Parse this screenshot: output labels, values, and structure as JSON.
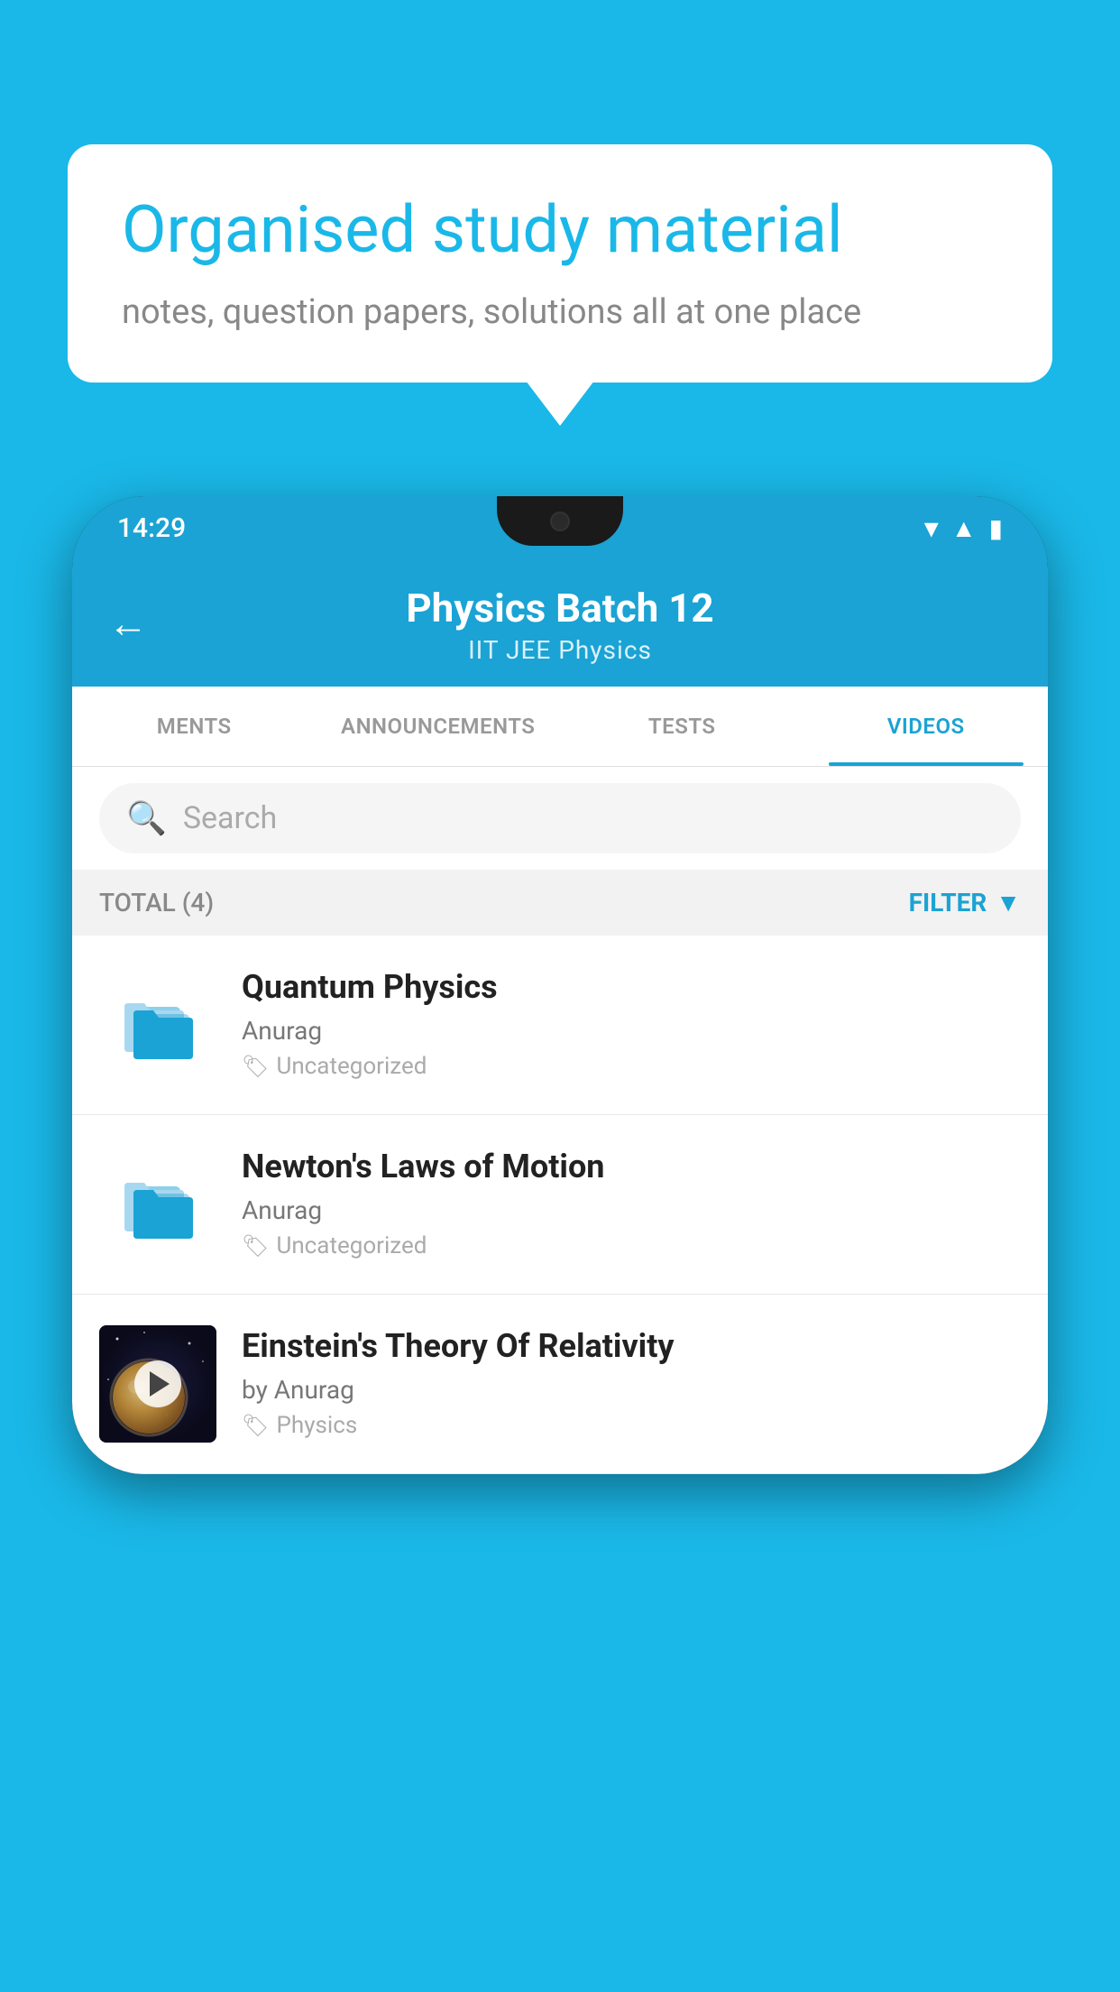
{
  "background_color": "#1ab8e8",
  "speech_bubble": {
    "title": "Organised study material",
    "subtitle": "notes, question papers, solutions all at one place"
  },
  "status_bar": {
    "time": "14:29"
  },
  "app_header": {
    "back_icon": "←",
    "title": "Physics Batch 12",
    "subtitle": "IIT JEE   Physics"
  },
  "tabs": [
    {
      "label": "MENTS",
      "active": false
    },
    {
      "label": "ANNOUNCEMENTS",
      "active": false
    },
    {
      "label": "TESTS",
      "active": false
    },
    {
      "label": "VIDEOS",
      "active": true
    }
  ],
  "search": {
    "placeholder": "Search"
  },
  "filter_bar": {
    "total_label": "TOTAL (4)",
    "filter_label": "FILTER"
  },
  "videos": [
    {
      "type": "folder",
      "title": "Quantum Physics",
      "author": "Anurag",
      "tag": "Uncategorized"
    },
    {
      "type": "folder",
      "title": "Newton's Laws of Motion",
      "author": "Anurag",
      "tag": "Uncategorized"
    },
    {
      "type": "video",
      "title": "Einstein's Theory Of Relativity",
      "author": "by Anurag",
      "tag": "Physics"
    }
  ]
}
